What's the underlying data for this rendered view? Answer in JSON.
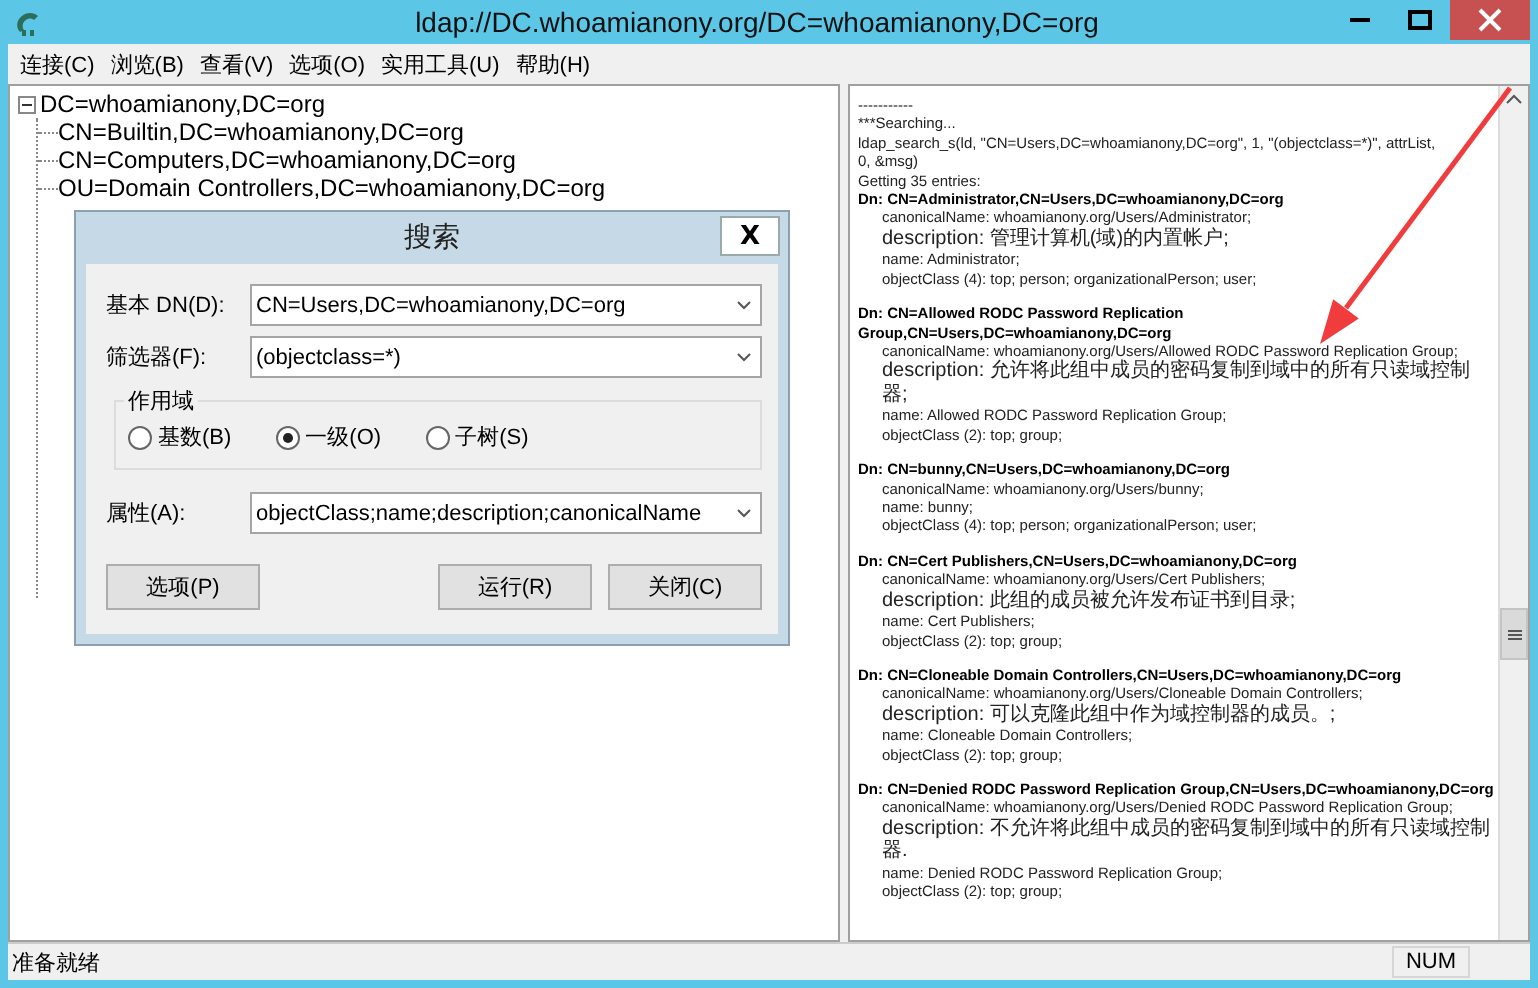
{
  "window": {
    "title": "ldap://DC.whoamianony.org/DC=whoamianony,DC=org"
  },
  "menu": [
    {
      "label": "连接(C)"
    },
    {
      "label": "浏览(B)"
    },
    {
      "label": "查看(V)"
    },
    {
      "label": "选项(O)"
    },
    {
      "label": "实用工具(U)"
    },
    {
      "label": "帮助(H)"
    }
  ],
  "tree": {
    "label": "DC=whoamianony,DC=org",
    "expanded": true,
    "children": [
      {
        "label": "CN=Builtin,DC=whoamianony,DC=org"
      },
      {
        "label": "CN=Computers,DC=whoamianony,DC=org"
      },
      {
        "label": "OU=Domain Controllers,DC=whoamianony,DC=org"
      }
    ]
  },
  "output": {
    "header_lines": [
      "-----------",
      "***Searching...",
      "ldap_search_s(ld, \"CN=Users,DC=whoamianony,DC=org\", 1, \"(objectclass=*)\", attrList,  0, &msg)",
      "Getting 35 entries:"
    ],
    "entries": [
      {
        "dn": "Dn: CN=Administrator,CN=Users,DC=whoamianony,DC=org",
        "attributes": [
          "canonicalName: whoamianony.org/Users/Administrator;",
          "description: 管理计算机(域)的内置帐户;",
          "name: Administrator;",
          "objectClass (4): top; person; organizationalPerson; user;"
        ]
      },
      {
        "dn": "Dn: CN=Allowed RODC Password Replication Group,CN=Users,DC=whoamianony,DC=org",
        "attributes": [
          "canonicalName: whoamianony.org/Users/Allowed RODC Password Replication Group;",
          "description: 允许将此组中成员的密码复制到域中的所有只读域控制器;",
          "name: Allowed RODC Password Replication Group;",
          "objectClass (2): top; group;"
        ]
      },
      {
        "dn": "Dn: CN=bunny,CN=Users,DC=whoamianony,DC=org",
        "attributes": [
          "canonicalName: whoamianony.org/Users/bunny;",
          "name: bunny;",
          "objectClass (4): top; person; organizationalPerson; user;"
        ]
      },
      {
        "dn": "Dn: CN=Cert Publishers,CN=Users,DC=whoamianony,DC=org",
        "attributes": [
          "canonicalName: whoamianony.org/Users/Cert Publishers;",
          "description: 此组的成员被允许发布证书到目录;",
          "name: Cert Publishers;",
          "objectClass (2): top; group;"
        ]
      },
      {
        "dn": "Dn: CN=Cloneable Domain Controllers,CN=Users,DC=whoamianony,DC=org",
        "attributes": [
          "canonicalName: whoamianony.org/Users/Cloneable Domain Controllers;",
          "description: 可以克隆此组中作为域控制器的成员。;",
          "name: Cloneable Domain Controllers;",
          "objectClass (2): top; group;"
        ]
      },
      {
        "dn": "Dn: CN=Denied RODC Password Replication Group,CN=Users,DC=whoamianony,DC=org",
        "attributes": [
          "canonicalName: whoamianony.org/Users/Denied RODC Password Replication Group;",
          "description: 不允许将此组中成员的密码复制到域中的所有只读域控制器.",
          "name: Denied RODC Password Replication Group;",
          "objectClass (2): top; group;"
        ]
      }
    ]
  },
  "dialog": {
    "title": "搜索",
    "close_label": "X",
    "fields": [
      {
        "label": "基本 DN(D):",
        "value": "CN=Users,DC=whoamianony,DC=org"
      },
      {
        "label": "筛选器(F):",
        "value": "(objectclass=*)"
      }
    ],
    "scope": {
      "label": "作用域",
      "options": [
        {
          "label": "基数(B)",
          "selected": false
        },
        {
          "label": "一级(O)",
          "selected": true
        },
        {
          "label": "子树(S)",
          "selected": false
        }
      ]
    },
    "attributes_field": {
      "label": "属性(A):",
      "value": "objectClass;name;description;canonicalName"
    },
    "buttons": [
      "选项(P)",
      "运行(R)",
      "关闭(C)"
    ]
  },
  "status_bar": {
    "text": "准备就绪",
    "indicator": "NUM"
  }
}
